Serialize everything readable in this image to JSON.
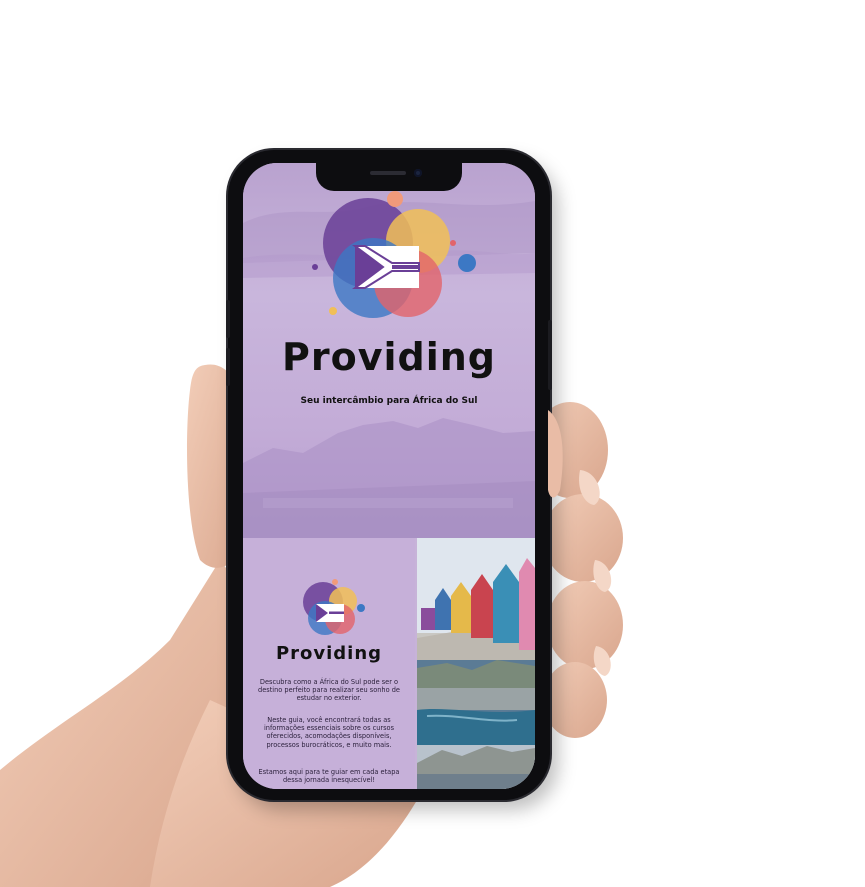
{
  "app": {
    "brand": "Providing",
    "tagline": "Seu intercâmbio para África do Sul"
  },
  "panel": {
    "brand": "Providing",
    "paragraphs": [
      "Descubra como a África do Sul pode ser o destino perfeito para realizar seu sonho de estudar no exterior.",
      "Neste guia, você encontrará todas as informações essenciais sobre os cursos oferecidos, acomodações disponíveis, processos burocráticos, e muito mais.",
      "Estamos aqui para te guiar em cada etapa dessa jornada inesquecível!"
    ]
  },
  "colors": {
    "hero_purple": "#c5aedb",
    "logo_purple": "#6a3f97",
    "logo_blue": "#3c78c4",
    "logo_yellow": "#f1bf57",
    "logo_red": "#e2646a"
  },
  "icons": {
    "flag": "south-africa-flag-icon"
  }
}
